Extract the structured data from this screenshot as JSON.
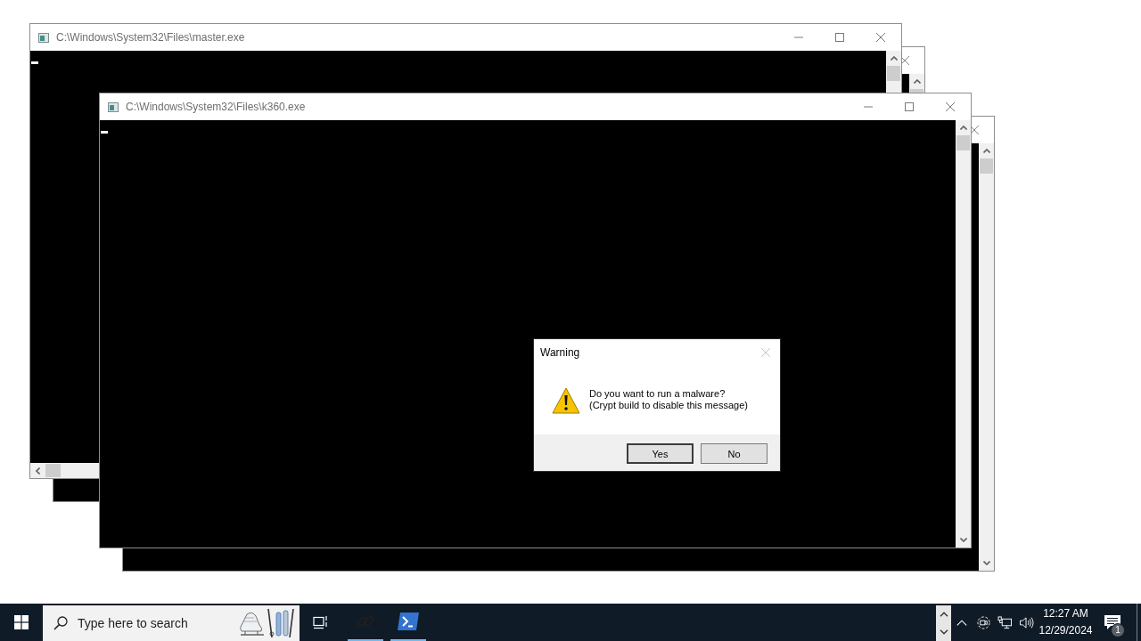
{
  "desktop": {
    "windows": [
      {
        "kind": "behind"
      },
      {
        "kind": "console",
        "title": "C:\\Windows\\System32\\Files\\master.exe",
        "horizontal_scrollbar": true
      },
      {
        "kind": "behind"
      },
      {
        "kind": "console",
        "title": "C:\\Windows\\System32\\Files\\k360.exe",
        "horizontal_scrollbar": false
      }
    ]
  },
  "dialog": {
    "title": "Warning",
    "close_disabled": true,
    "message": [
      "Do you want to run a malware?",
      "(Crypt build to disable this message)"
    ],
    "buttons": [
      {
        "label": "Yes",
        "default": true
      },
      {
        "label": "No",
        "default": false
      }
    ]
  },
  "taskbar": {
    "search": {
      "placeholder": "Type here to search"
    },
    "apps": [
      {
        "kind": "link",
        "running": true
      },
      {
        "kind": "powershell",
        "running": true
      }
    ],
    "clock": {
      "time": "12:27 AM",
      "date": "12/29/2024"
    },
    "notifications": {
      "count": "1"
    }
  }
}
